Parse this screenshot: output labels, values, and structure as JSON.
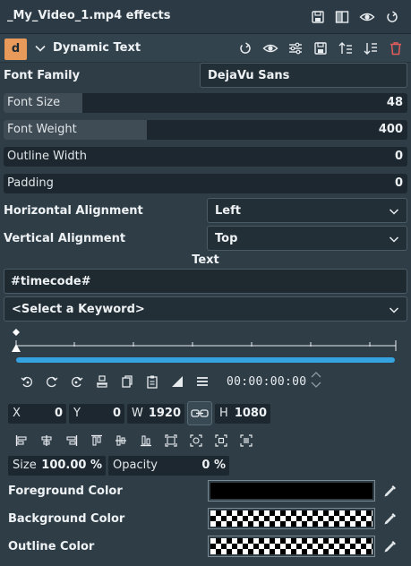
{
  "title": "_My_Video_1.mp4 effects",
  "title_icons": [
    "save-preset-icon",
    "split-compare-icon",
    "eye-icon",
    "reset-icon"
  ],
  "effect": {
    "badge": "d",
    "name": "Dynamic Text",
    "header_icons": [
      "reset-icon",
      "eye-icon",
      "settings-sliders-icon",
      "save-icon",
      "move-up-icon",
      "move-down-icon",
      "delete-icon"
    ]
  },
  "font_family": {
    "label": "Font Family",
    "value": "DejaVu Sans"
  },
  "font_size": {
    "label": "Font Size",
    "value": "48",
    "fraction": 0.195
  },
  "font_weight": {
    "label": "Font Weight",
    "value": "400",
    "fraction": 0.355
  },
  "outline_width": {
    "label": "Outline Width",
    "value": "0",
    "fraction": 0
  },
  "padding": {
    "label": "Padding",
    "value": "0",
    "fraction": 0
  },
  "horizontal_alignment": {
    "label": "Horizontal Alignment",
    "value": "Left"
  },
  "vertical_alignment": {
    "label": "Vertical Alignment",
    "value": "Top"
  },
  "text": {
    "heading": "Text",
    "value": "#timecode#",
    "keyword_placeholder": "<Select a Keyword>"
  },
  "timecode": "00:00:00:00",
  "geometry": {
    "x": {
      "label": "X",
      "value": "0"
    },
    "y": {
      "label": "Y",
      "value": "0"
    },
    "w": {
      "label": "W",
      "value": "1920"
    },
    "h": {
      "label": "H",
      "value": "1080"
    }
  },
  "size": {
    "label": "Size",
    "value": "100.00 %"
  },
  "opacity": {
    "label": "Opacity",
    "value": "0 %"
  },
  "colors": {
    "foreground": {
      "label": "Foreground Color",
      "value": "#000000"
    },
    "background": {
      "label": "Background Color",
      "value": "transparent"
    },
    "outline": {
      "label": "Outline Color",
      "value": "transparent"
    }
  },
  "accent_color": "#34a3e0",
  "badge_color": "#e89a5a",
  "delete_color": "#e25c5c"
}
